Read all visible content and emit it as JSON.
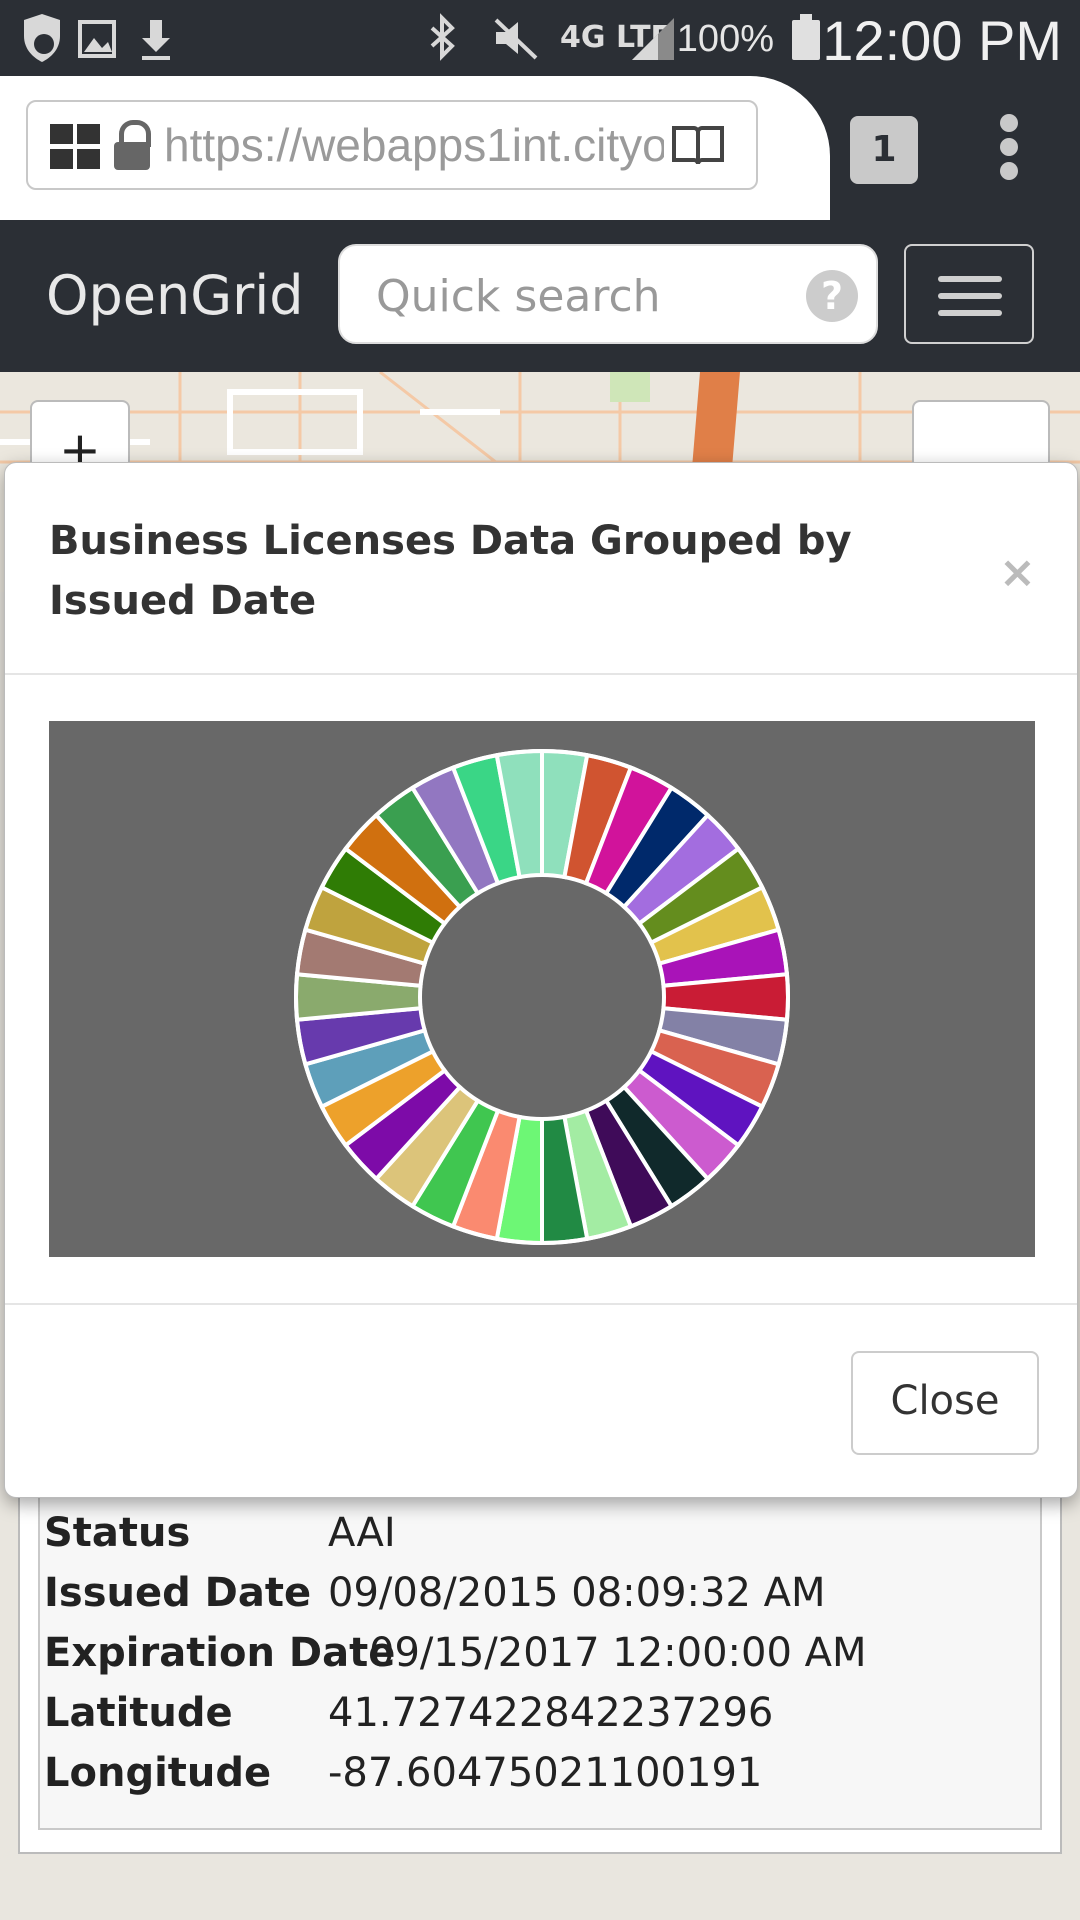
{
  "status_bar": {
    "time": "12:00 PM",
    "battery_percent": "100%",
    "network": "4G LTE",
    "icons": [
      "shield-icon",
      "image-icon",
      "download-icon",
      "bluetooth-icon",
      "mute-icon",
      "signal-icon",
      "battery-icon"
    ]
  },
  "browser": {
    "url": "https://webapps1int.cityo",
    "tab_count": "1"
  },
  "app": {
    "brand": "OpenGrid",
    "search_placeholder": "Quick search",
    "help_label": "?"
  },
  "map": {
    "zoom_in_label": "+"
  },
  "modal": {
    "title": "Business Licenses Data Grouped by Issued Date",
    "close_x": "×",
    "close_button": "Close"
  },
  "info": {
    "rows": [
      {
        "key": "Status",
        "value": "AAI"
      },
      {
        "key": "Issued Date",
        "value": "09/08/2015 08:09:32 AM"
      },
      {
        "key": "Expiration Date",
        "value": "09/15/2017 12:00:00 AM"
      },
      {
        "key": "Latitude",
        "value": "41.727422842237296"
      },
      {
        "key": "Longitude",
        "value": "-87.60475021100191"
      }
    ]
  },
  "chart_data": {
    "type": "pie",
    "donut": true,
    "slice_count": 34,
    "values": [
      1,
      1,
      1,
      1,
      1,
      1,
      1,
      1,
      1,
      1,
      1,
      1,
      1,
      1,
      1,
      1,
      1,
      1,
      1,
      1,
      1,
      1,
      1,
      1,
      1,
      1,
      1,
      1,
      1,
      1,
      1,
      1,
      1,
      1
    ],
    "colors": [
      "#8fe0bc",
      "#d05430",
      "#d1139b",
      "#00296b",
      "#a36ddf",
      "#648d1e",
      "#e2c24c",
      "#a913b8",
      "#c91c35",
      "#8381a6",
      "#d96250",
      "#5f13c0",
      "#cc5bcf",
      "#10292b",
      "#3f0b59",
      "#a3eca3",
      "#218a44",
      "#6df775",
      "#fa8a70",
      "#40c650",
      "#dcc47a",
      "#7d0ba8",
      "#eda12b",
      "#5e9fba",
      "#673aad",
      "#8aaa6d",
      "#a37a72",
      "#bfa33e",
      "#2f7c05",
      "#d0700f",
      "#3a9f50",
      "#9277c1",
      "#3ad686",
      "#8fe0bc"
    ],
    "background": "#686868",
    "title": "",
    "legend": "none"
  }
}
